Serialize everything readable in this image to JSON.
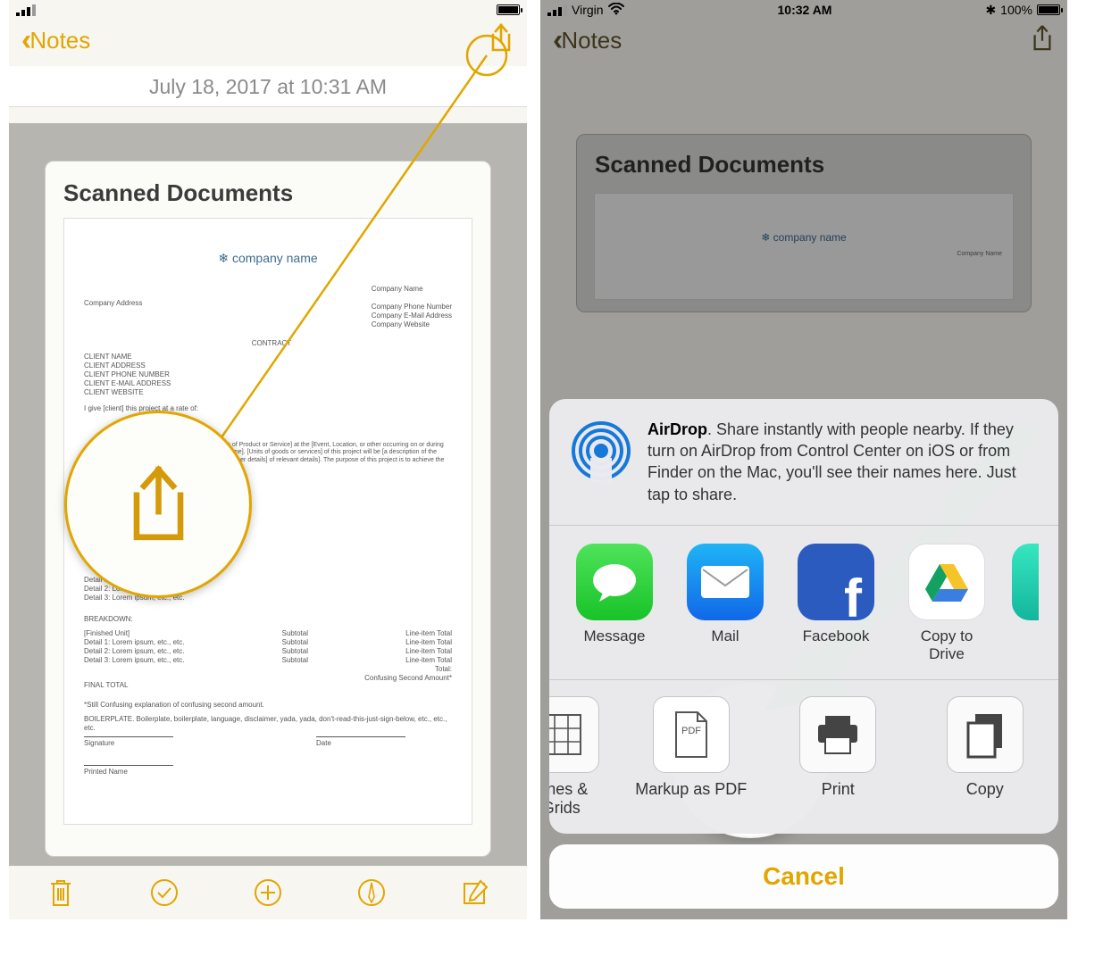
{
  "left": {
    "status": {
      "carrier": "",
      "time": "",
      "battery": ""
    },
    "nav": {
      "back": "Notes"
    },
    "timestamp": "July 18, 2017 at 10:31 AM",
    "card_title": "Scanned Documents",
    "document": {
      "company_logo": "company name",
      "company_name_ln": "Company Name",
      "company_address": "Company Address",
      "company_phone": "Company Phone Number",
      "company_email": "Company E-Mail Address",
      "company_web": "Company Website",
      "contract": "CONTRACT",
      "client_name": "CLIENT NAME",
      "client_address": "CLIENT ADDRESS",
      "client_phone": "CLIENT PHONE NUMBER",
      "client_email": "CLIENT E-MAIL ADDRESS",
      "client_web": "CLIENT WEBSITE",
      "give": "I give [client] this project at a rate of:",
      "paragraph": "[the Final Product] [Type of Product or Service] at the [Event, Location, or other occurring on or during [specified date or time-frame]. [Units of goods or services] of this project will be [a description of the primary result entered]. [Other details] of relevant details]. The purpose of this project is to achieve the [primary result intended].",
      "d1": "Detail 1: Lorem ipsum, etc., etc.",
      "d2": "Detail 2: Lorem ipsum, etc., etc.",
      "d3": "Detail 3: Lorem ipsum, etc., etc.",
      "breakdown": "BREAKDOWN:",
      "col1": "[Finished Unit]\nDetail 1: Lorem ipsum, etc., etc.\nDetail 2: Lorem ipsum, etc., etc.\nDetail 3: Lorem ipsum, etc., etc.",
      "col2": "Subtotal\nSubtotal\nSubtotal\nSubtotal",
      "col3": "Line-item Total\nLine-item Total\nLine-item Total\nLine-item Total",
      "total": "Total:\nConfusing Second Amount*",
      "final": "FINAL TOTAL",
      "still": "*Still Confusing explanation of confusing second amount.",
      "boiler": "BOILERPLATE. Boilerplate, boilerplate, language, disclaimer, yada, yada, don't-read-this-just-sign-below, etc., etc., etc.",
      "signature": "Signature",
      "date": "Date",
      "printed": "Printed Name"
    },
    "toolbar": [
      "trash-icon",
      "check-icon",
      "add-icon",
      "draw-icon",
      "compose-icon"
    ]
  },
  "right": {
    "status": {
      "carrier": "Virgin",
      "time": "10:32 AM",
      "battery": "100%"
    },
    "nav": {
      "back": "Notes"
    },
    "card_title": "Scanned Documents",
    "minidoc": {
      "logo": "company name",
      "company_name": "Company Name"
    },
    "sheet": {
      "airdrop_bold": "AirDrop",
      "airdrop_text": ". Share instantly with people nearby. If they turn on AirDrop from Control Center on iOS or from Finder on the Mac, you'll see their names here. Just tap to share.",
      "apps": [
        "Message",
        "Mail",
        "Facebook",
        "Copy to Drive"
      ],
      "actions_trunc_left": "Lines & Grids",
      "actions": [
        "Markup as PDF",
        "Print",
        "Copy"
      ],
      "pdf_badge": "PDF",
      "cancel": "Cancel"
    }
  }
}
